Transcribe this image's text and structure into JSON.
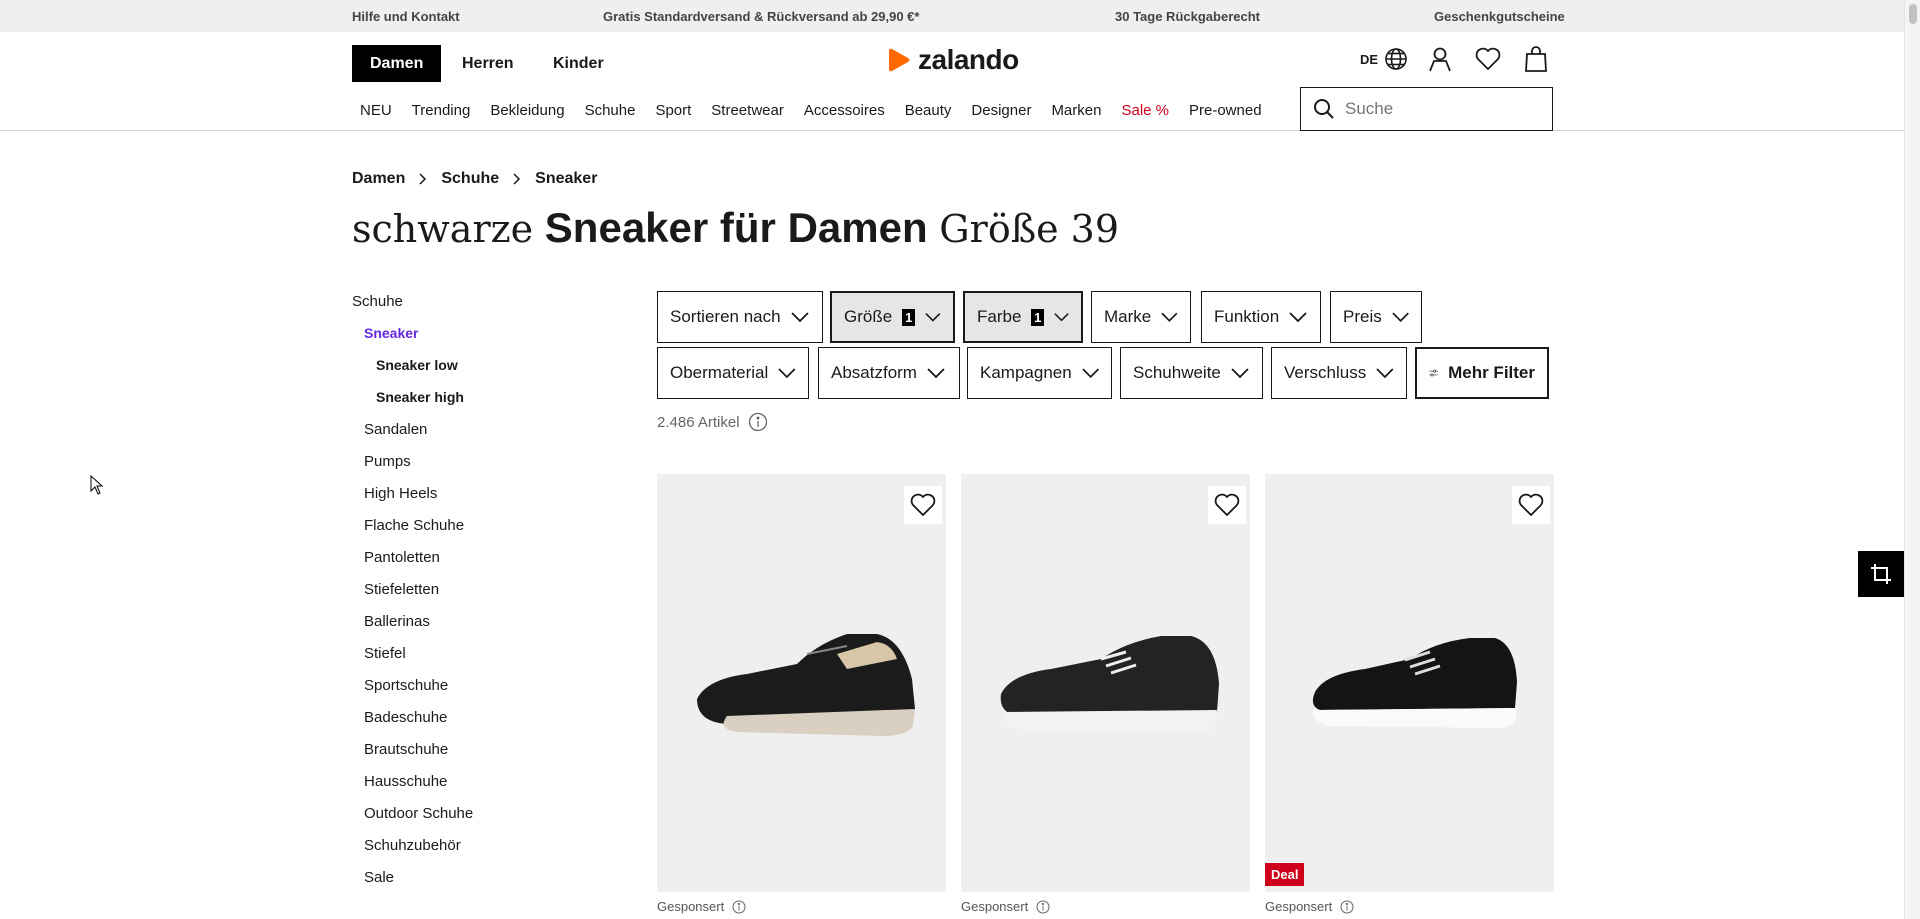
{
  "topbar": {
    "help": "Hilfe und Kontakt",
    "shipping": "Gratis Standardversand & Rückversand ab 29,90 €*",
    "returns": "30 Tage Rückgaberecht",
    "giftcards": "Geschenkgutscheine"
  },
  "header": {
    "genders": [
      "Damen",
      "Herren",
      "Kinder"
    ],
    "logo": "zalando",
    "lang": "DE",
    "icons": [
      "globe-icon",
      "user-icon",
      "heart-icon",
      "bag-icon"
    ]
  },
  "nav": {
    "items": [
      "NEU",
      "Trending",
      "Bekleidung",
      "Schuhe",
      "Sport",
      "Streetwear",
      "Accessoires",
      "Beauty",
      "Designer",
      "Marken",
      "Sale %",
      "Pre-owned"
    ]
  },
  "search": {
    "placeholder": "Suche"
  },
  "breadcrumb": [
    "Damen",
    "Schuhe",
    "Sneaker"
  ],
  "title": {
    "prefix": "schwarze",
    "main": "Sneaker für Damen",
    "suffix": "Größe 39"
  },
  "sidebar": {
    "root": "Schuhe",
    "current": "Sneaker",
    "sub": [
      "Sneaker low",
      "Sneaker high"
    ],
    "categories": [
      "Sandalen",
      "Pumps",
      "High Heels",
      "Flache Schuhe",
      "Pantoletten",
      "Stiefeletten",
      "Ballerinas",
      "Stiefel",
      "Sportschuhe",
      "Badeschuhe",
      "Brautschuhe",
      "Hausschuhe",
      "Outdoor Schuhe",
      "Schuhzubehör",
      "Sale"
    ]
  },
  "filters": {
    "row1": [
      {
        "label": "Sortieren nach"
      },
      {
        "label": "Größe",
        "count": "1"
      },
      {
        "label": "Farbe",
        "count": "1"
      },
      {
        "label": "Marke"
      },
      {
        "label": "Funktion"
      },
      {
        "label": "Preis"
      }
    ],
    "row2": [
      {
        "label": "Obermaterial"
      },
      {
        "label": "Absatzform"
      },
      {
        "label": "Kampagnen"
      },
      {
        "label": "Schuhweite"
      },
      {
        "label": "Verschluss"
      }
    ],
    "more": "Mehr Filter"
  },
  "results": {
    "count": "2.486 Artikel"
  },
  "products": [
    {
      "sponsored": "Gesponsert",
      "badge": ""
    },
    {
      "sponsored": "Gesponsert",
      "badge": ""
    },
    {
      "sponsored": "Gesponsert",
      "badge": "Deal"
    }
  ],
  "colors": {
    "accent": "#ff6900",
    "sale": "#d0021b",
    "active_sub": "#6328e0"
  }
}
